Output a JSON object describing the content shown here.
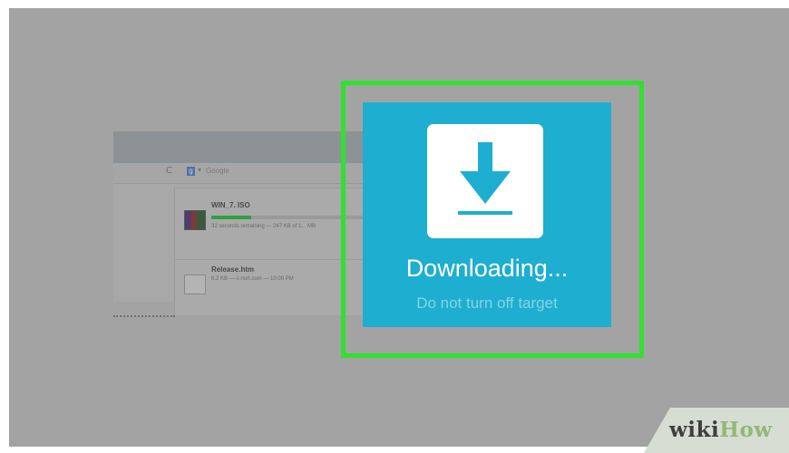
{
  "browser": {
    "reload_glyph": "C",
    "search_engine_label": "Google"
  },
  "downloads": [
    {
      "filename": "WIN_7. ISO",
      "status": "32 seconds remaining — 247 KB of 1... MB",
      "progress": 0.26,
      "icon": "rar-archive-icon"
    },
    {
      "filename": "Release.htm",
      "status": "6.2 KB — c-nort.com — 10:00 PM",
      "icon": "document-icon"
    }
  ],
  "overlay": {
    "title": "Downloading...",
    "subtitle": "Do not turn off target",
    "icon": "download-arrow-icon",
    "background_color": "#1eaecf",
    "highlight_color": "#31e030"
  },
  "watermark": {
    "part1": "wiki",
    "part2": "How"
  }
}
